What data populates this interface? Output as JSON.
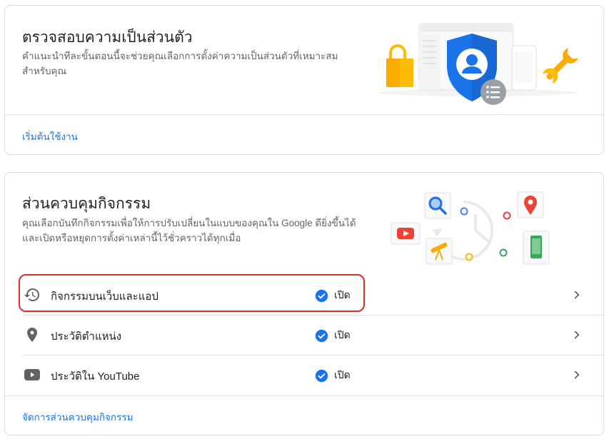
{
  "privacy_card": {
    "title": "ตรวจสอบความเป็นส่วนตัว",
    "description": "คำแนะนำทีละขั้นตอนนี้จะช่วยคุณเลือกการตั้งค่าความเป็นส่วนตัวที่เหมาะสมสำหรับคุณ",
    "link": "เริ่มต้นใช้งาน",
    "illustration_icons": [
      "lock-icon",
      "shield-user-icon",
      "list-icon",
      "wrench-icon",
      "phone-icon"
    ]
  },
  "activity_card": {
    "title": "ส่วนควบคุมกิจกรรม",
    "description": "คุณเลือกบันทึกกิจกรรมเพื่อให้การปรับเปลี่ยนในแบบของคุณใน Google ดียิ่งขึ้นได้ และเปิดหรือหยุดการตั้งค่าเหล่านี้ไว้ชั่วคราวได้ทุกเมื่อ",
    "link": "จัดการส่วนควบคุมกิจกรรม",
    "illustration_icons": [
      "search-icon",
      "youtube-icon",
      "telescope-icon",
      "map-pin-icon",
      "phone-icon",
      "history-clock-icon"
    ],
    "rows": [
      {
        "icon": "history-icon",
        "label": "กิจกรรมบนเว็บและแอป",
        "status": "เปิด",
        "highlighted": true
      },
      {
        "icon": "location-pin-icon",
        "label": "ประวัติตำแหน่ง",
        "status": "เปิด",
        "highlighted": false
      },
      {
        "icon": "youtube-icon",
        "label": "ประวัติใน YouTube",
        "status": "เปิด",
        "highlighted": false
      }
    ]
  },
  "colors": {
    "link": "#1a73e8",
    "check": "#1a73e8",
    "highlight": "#d93025",
    "divider": "#e0e0e0"
  }
}
